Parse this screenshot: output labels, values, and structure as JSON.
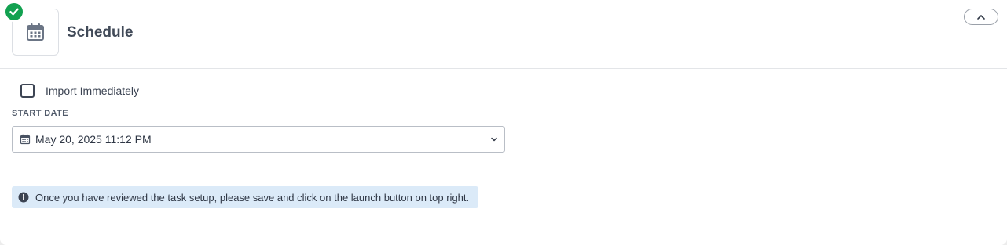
{
  "section": {
    "title": "Schedule",
    "status": "complete",
    "icon": "calendar-icon",
    "collapse_icon": "chevron-up-icon"
  },
  "import_immediately": {
    "label": "Import Immediately",
    "checked": false
  },
  "start_date": {
    "label": "START DATE",
    "value": "May 20, 2025 11:12 PM",
    "icon": "calendar-icon",
    "dropdown_icon": "chevron-down-icon"
  },
  "notice": {
    "icon": "info-icon",
    "text": "Once you have reviewed the task setup, please save and click on the launch button on top right."
  },
  "colors": {
    "success": "#12a150",
    "info_bg": "#dbeaf8",
    "text": "#3b4352"
  }
}
